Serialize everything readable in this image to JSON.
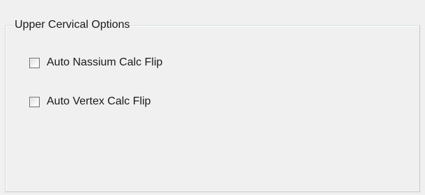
{
  "group": {
    "title": "Upper Cervical Options"
  },
  "options": [
    {
      "label": "Auto Nassium Calc Flip",
      "checked": false
    },
    {
      "label": "Auto Vertex Calc Flip",
      "checked": false
    }
  ]
}
